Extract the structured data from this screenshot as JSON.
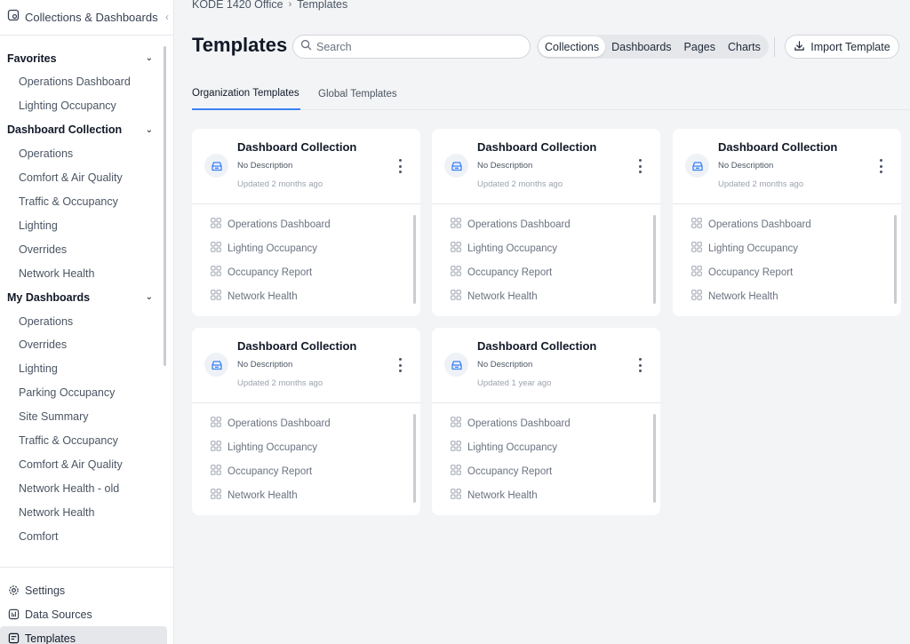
{
  "sidebar": {
    "header_label": "Collections & Dashboards",
    "sections": [
      {
        "title": "Favorites",
        "items": [
          "Operations Dashboard",
          "Lighting Occupancy"
        ]
      },
      {
        "title": "Dashboard Collection",
        "items": [
          "Operations",
          "Comfort & Air Quality",
          "Traffic & Occupancy",
          "Lighting",
          "Overrides",
          "Network Health"
        ]
      },
      {
        "title": "My Dashboards",
        "items": [
          "Operations",
          "Overrides",
          "Lighting",
          "Parking Occupancy",
          "Site Summary",
          "Traffic & Occupancy",
          "Comfort & Air Quality",
          "Network Health - old",
          "Network Health",
          "Comfort"
        ]
      }
    ],
    "bottom": [
      {
        "label": "Settings",
        "icon": "gear-icon"
      },
      {
        "label": "Data Sources",
        "icon": "chart-icon"
      },
      {
        "label": "Templates",
        "icon": "template-icon",
        "active": true
      }
    ]
  },
  "breadcrumb": [
    "KODE 1420 Office",
    "Templates"
  ],
  "page_title": "Templates",
  "search": {
    "placeholder": "Search",
    "value": ""
  },
  "filters": [
    {
      "label": "Collections",
      "active": true
    },
    {
      "label": "Dashboards"
    },
    {
      "label": "Pages"
    },
    {
      "label": "Charts"
    }
  ],
  "import_label": "Import Template",
  "tabs": [
    {
      "label": "Organization Templates",
      "active": true
    },
    {
      "label": "Global Templates"
    }
  ],
  "colors": {
    "accent": "#3b82f6",
    "icon_blue": "#3b82f6"
  },
  "cards": [
    {
      "title": "Dashboard Collection",
      "description": "No Description",
      "updated": "Updated 2 months ago",
      "items": [
        "Operations Dashboard",
        "Lighting Occupancy",
        "Occupancy Report",
        "Network Health"
      ]
    },
    {
      "title": "Dashboard Collection",
      "description": "No Description",
      "updated": "Updated 2 months ago",
      "items": [
        "Operations Dashboard",
        "Lighting Occupancy",
        "Occupancy Report",
        "Network Health"
      ]
    },
    {
      "title": "Dashboard Collection",
      "description": "No Description",
      "updated": "Updated 2 months ago",
      "items": [
        "Operations Dashboard",
        "Lighting Occupancy",
        "Occupancy Report",
        "Network Health"
      ]
    },
    {
      "title": "Dashboard Collection",
      "description": "No Description",
      "updated": "Updated 2 months ago",
      "items": [
        "Operations Dashboard",
        "Lighting Occupancy",
        "Occupancy Report",
        "Network Health"
      ]
    },
    {
      "title": "Dashboard Collection",
      "description": "No Description",
      "updated": "Updated 1 year ago",
      "items": [
        "Operations Dashboard",
        "Lighting Occupancy",
        "Occupancy Report",
        "Network Health"
      ]
    }
  ]
}
